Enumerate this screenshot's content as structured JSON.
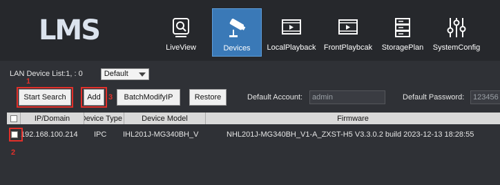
{
  "app": {
    "logo_text": "LMS"
  },
  "nav": [
    {
      "label": "LiveView",
      "icon": "liveview-icon",
      "active": false
    },
    {
      "label": "Devices",
      "icon": "camera-devices-icon",
      "active": true
    },
    {
      "label": "LocalPlayback",
      "icon": "film-playback-icon",
      "active": false
    },
    {
      "label": "FrontPlaybcak",
      "icon": "film-playback-icon",
      "active": false
    },
    {
      "label": "StoragePlan",
      "icon": "storage-icon",
      "active": false
    },
    {
      "label": "SystemConfig",
      "icon": "sliders-icon",
      "active": false
    }
  ],
  "device_list": {
    "label": "LAN Device List:1, : 0",
    "filter_selected": "Default"
  },
  "toolbar": {
    "start_search": "Start Search",
    "add": "Add",
    "batch_modify_ip": "BatchModifyIP",
    "restore": "Restore",
    "default_account_label": "Default Account:",
    "default_account_value": "admin",
    "default_password_label": "Default Password:",
    "default_password_value": "123456"
  },
  "annotations": {
    "step1": "1",
    "step2": "2",
    "step3": "3"
  },
  "table": {
    "columns": [
      "IP/Domain",
      "Device Type",
      "Device Model",
      "Firmware"
    ],
    "rows": [
      {
        "ip": "192.168.100.214",
        "type": "IPC",
        "model": "IHL201J-MG340BH_V",
        "firmware": "NHL201J-MG340BH_V1-A_ZXST-H5 V3.3.0.2 build 2023-12-13 18:28:55"
      }
    ]
  },
  "colors": {
    "accent": "#3a79b7",
    "annotation_red": "#e3302a"
  }
}
